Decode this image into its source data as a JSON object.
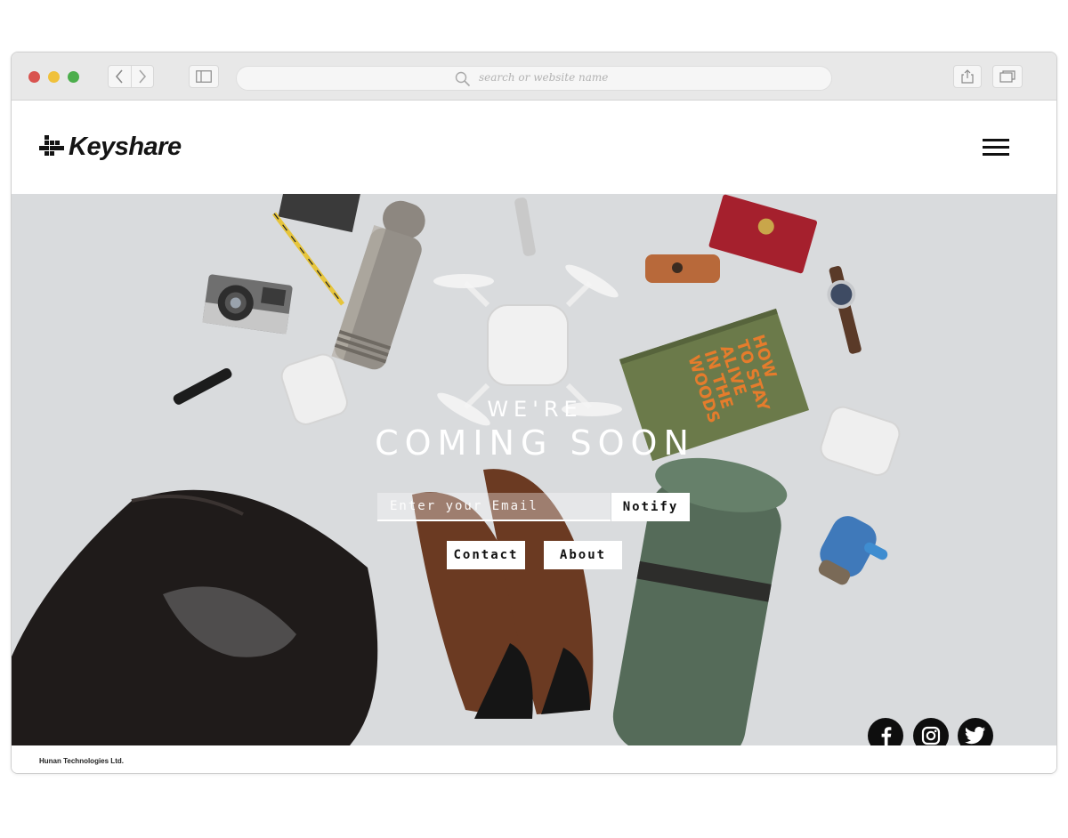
{
  "browser": {
    "address_placeholder": "search or website name",
    "colors": {
      "close": "#d9534f",
      "minimize": "#f0c13b",
      "zoom": "#4cae4c"
    }
  },
  "site": {
    "brand": "Keyshare",
    "headline_small": "WE'RE",
    "headline_big": "COMING SOON",
    "email_placeholder": "Enter your Email",
    "notify_label": "Notify",
    "contact_label": "Contact",
    "about_label": "About",
    "book_title": "HOW TO STAY ALIVE IN THE WOODS",
    "footer": "Hunan Technologies Ltd."
  },
  "social": [
    "facebook-icon",
    "instagram-icon",
    "twitter-icon"
  ]
}
